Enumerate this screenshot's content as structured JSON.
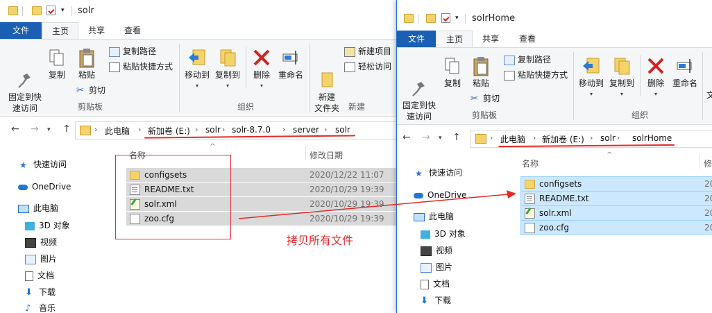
{
  "left": {
    "title": "solr",
    "tabs": [
      "文件",
      "主页",
      "共享",
      "查看"
    ],
    "ribbon": {
      "pin": "固定到快\n速访问",
      "copy": "复制",
      "paste": "粘贴",
      "copy_path": "复制路径",
      "paste_shortcut": "粘贴快捷方式",
      "cut": "剪切",
      "clipboard_label": "剪贴板",
      "move_to": "移动到",
      "copy_to": "复制到",
      "delete": "删除",
      "rename": "重命名",
      "organize_label": "组织",
      "new_folder": "新建\n文件夹",
      "new_item": "新建项目",
      "easy_access": "轻松访问",
      "new_label": "新建"
    },
    "breadcrumb": [
      "此电脑",
      "新加卷 (E:)",
      "solr",
      "solr-8.7.0",
      "server",
      "solr"
    ],
    "columns": {
      "name": "名称",
      "date": "修改日期"
    },
    "nav": [
      "快速访问",
      "OneDrive",
      "此电脑",
      "3D 对象",
      "视频",
      "图片",
      "文档",
      "下载",
      "音乐"
    ],
    "files": [
      {
        "name": "configsets",
        "date": "2020/12/22 11:07",
        "type": "folder"
      },
      {
        "name": "README.txt",
        "date": "2020/10/29 19:39",
        "type": "txt"
      },
      {
        "name": "solr.xml",
        "date": "2020/10/29 19:39",
        "type": "xml"
      },
      {
        "name": "zoo.cfg",
        "date": "2020/10/29 19:39",
        "type": "cfg"
      }
    ],
    "annotation": "拷贝所有文件"
  },
  "right": {
    "title": "solrHome",
    "tabs": [
      "文件",
      "主页",
      "共享",
      "查看"
    ],
    "ribbon": {
      "pin": "固定到快\n速访问",
      "copy": "复制",
      "paste": "粘贴",
      "copy_path": "复制路径",
      "paste_shortcut": "粘贴快捷方式",
      "cut": "剪切",
      "clipboard_label": "剪贴板",
      "move_to": "移动到",
      "copy_to": "复制到",
      "delete": "删除",
      "rename": "重命名",
      "organize_label": "组织",
      "cut_off": "文"
    },
    "breadcrumb": [
      "此电脑",
      "新加卷 (E:)",
      "solr",
      "solrHome"
    ],
    "columns": {
      "name": "名称",
      "date": "修"
    },
    "nav": [
      "快速访问",
      "OneDrive",
      "此电脑",
      "3D 对象",
      "视频",
      "图片",
      "文档",
      "下载"
    ],
    "files": [
      {
        "name": "configsets",
        "date": "20",
        "type": "folder"
      },
      {
        "name": "README.txt",
        "date": "20",
        "type": "txt"
      },
      {
        "name": "solr.xml",
        "date": "20",
        "type": "xml"
      },
      {
        "name": "zoo.cfg",
        "date": "20",
        "type": "cfg"
      }
    ]
  },
  "colors": {
    "file_tab": "#1a5fb4",
    "selection": "#cce8ff",
    "left_selection": "#d9d9d9",
    "annotation": "#e52a2a"
  },
  "icons": {
    "back": "←",
    "forward": "→",
    "up": "↑",
    "chevron": "›",
    "down": "▾",
    "sort": "^"
  }
}
